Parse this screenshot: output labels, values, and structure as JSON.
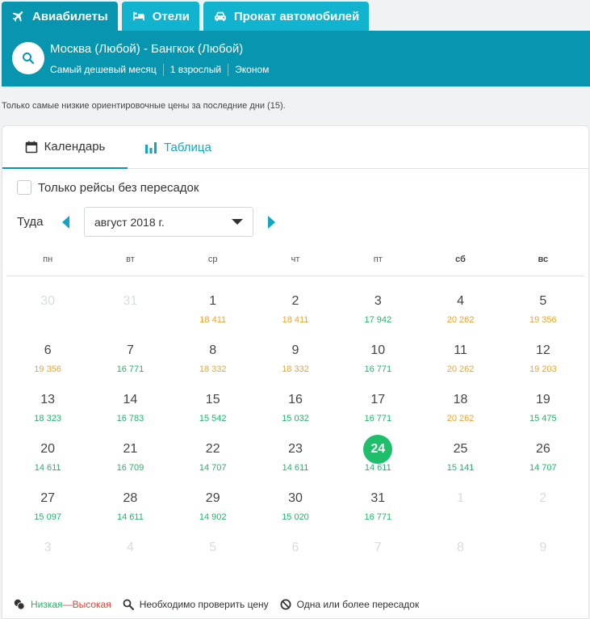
{
  "tabs": [
    {
      "label": "Авиабилеты",
      "icon": "plane-icon",
      "active": true
    },
    {
      "label": "Отели",
      "icon": "bed-icon",
      "active": false
    },
    {
      "label": "Прокат автомобилей",
      "icon": "car-icon",
      "active": false
    }
  ],
  "search": {
    "route": "Москва (Любой) - Бангкок (Любой)",
    "params": [
      "Самый дешевый месяц",
      "1 взрослый",
      "Эконом"
    ]
  },
  "note": "Только самые низкие ориентировочные цены за последние дни (15).",
  "view_tabs": {
    "calendar": "Календарь",
    "table": "Таблица"
  },
  "direct_only": "Только рейсы без пересадок",
  "direction_label": "Туда",
  "month": "август 2018 г.",
  "weekdays": [
    "пн",
    "вт",
    "ср",
    "чт",
    "пт",
    "сб",
    "вс"
  ],
  "days": [
    {
      "num": "30",
      "price": "",
      "muted": true
    },
    {
      "num": "31",
      "price": "",
      "muted": true
    },
    {
      "num": "1",
      "price": "18 411",
      "level": "mid"
    },
    {
      "num": "2",
      "price": "18 411",
      "level": "mid"
    },
    {
      "num": "3",
      "price": "17 942",
      "level": "low"
    },
    {
      "num": "4",
      "price": "20 262",
      "level": "mid"
    },
    {
      "num": "5",
      "price": "19 356",
      "level": "mid"
    },
    {
      "num": "6",
      "price": "19 356",
      "level": "mid"
    },
    {
      "num": "7",
      "price": "16 771",
      "level": "low"
    },
    {
      "num": "8",
      "price": "18 332",
      "level": "mid"
    },
    {
      "num": "9",
      "price": "18 332",
      "level": "mid"
    },
    {
      "num": "10",
      "price": "16 771",
      "level": "low"
    },
    {
      "num": "11",
      "price": "20 262",
      "level": "mid"
    },
    {
      "num": "12",
      "price": "19 203",
      "level": "mid"
    },
    {
      "num": "13",
      "price": "18 323",
      "level": "low"
    },
    {
      "num": "14",
      "price": "16 783",
      "level": "low"
    },
    {
      "num": "15",
      "price": "15 542",
      "level": "low"
    },
    {
      "num": "16",
      "price": "15 032",
      "level": "low"
    },
    {
      "num": "17",
      "price": "16 771",
      "level": "low"
    },
    {
      "num": "18",
      "price": "20 262",
      "level": "mid"
    },
    {
      "num": "19",
      "price": "15 475",
      "level": "low"
    },
    {
      "num": "20",
      "price": "14 611",
      "level": "low"
    },
    {
      "num": "21",
      "price": "16 709",
      "level": "low"
    },
    {
      "num": "22",
      "price": "14 707",
      "level": "low"
    },
    {
      "num": "23",
      "price": "14 611",
      "level": "low"
    },
    {
      "num": "24",
      "price": "14 611",
      "level": "low",
      "selected": true
    },
    {
      "num": "25",
      "price": "15 141",
      "level": "low"
    },
    {
      "num": "26",
      "price": "14 707",
      "level": "low"
    },
    {
      "num": "27",
      "price": "15 097",
      "level": "low"
    },
    {
      "num": "28",
      "price": "14 611",
      "level": "low"
    },
    {
      "num": "29",
      "price": "14 902",
      "level": "low"
    },
    {
      "num": "30",
      "price": "15 020",
      "level": "low"
    },
    {
      "num": "31",
      "price": "16 771",
      "level": "low"
    },
    {
      "num": "1",
      "price": "",
      "muted": true
    },
    {
      "num": "2",
      "price": "",
      "muted": true
    },
    {
      "num": "3",
      "price": "",
      "muted": true
    },
    {
      "num": "4",
      "price": "",
      "muted": true
    },
    {
      "num": "5",
      "price": "",
      "muted": true
    },
    {
      "num": "6",
      "price": "",
      "muted": true
    },
    {
      "num": "7",
      "price": "",
      "muted": true
    },
    {
      "num": "8",
      "price": "",
      "muted": true
    },
    {
      "num": "9",
      "price": "",
      "muted": true
    }
  ],
  "legend": {
    "low": "Низкая",
    "separator": "—",
    "high": "Высокая",
    "check_price": "Необходимо проверить цену",
    "stops": "Одна или более пересадок"
  },
  "colors": {
    "accent": "#0795b0",
    "tab": "#12b3cf",
    "low": "#24b26c",
    "mid": "#e9a530",
    "high": "#e0453a",
    "selected": "#1ebe6b"
  }
}
